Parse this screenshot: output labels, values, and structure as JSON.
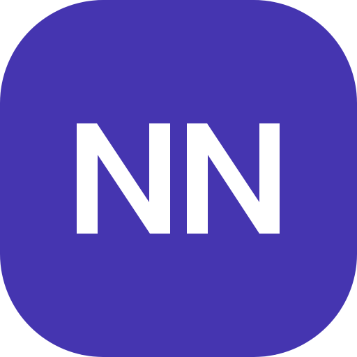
{
  "app_icon": {
    "monogram": "NN",
    "background_color": "#4535b0",
    "text_color": "#ffffff"
  }
}
